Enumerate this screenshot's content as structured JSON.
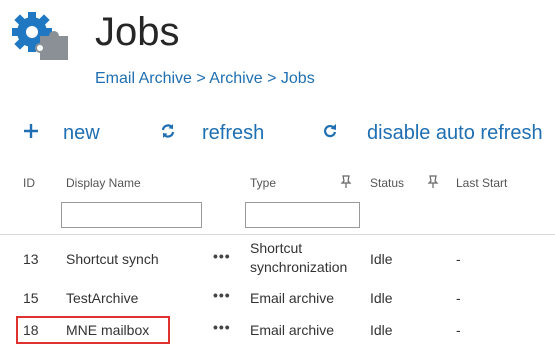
{
  "page": {
    "title": "Jobs",
    "breadcrumb": [
      "Email Archive",
      "Archive",
      "Jobs"
    ],
    "breadcrumb_separator": ">"
  },
  "toolbar": {
    "new": {
      "icon": "plus-icon",
      "label": "new"
    },
    "refresh": {
      "icon": "refresh-icon",
      "label": "refresh"
    },
    "disable_auto_refresh": {
      "icon": "auto-refresh-icon",
      "label": "disable auto refresh"
    }
  },
  "grid": {
    "columns": {
      "id": "ID",
      "display_name": "Display Name",
      "type": "Type",
      "status": "Status",
      "last_start": "Last Start"
    },
    "filters": {
      "display_name": "",
      "type": ""
    },
    "row_menu_label": "•••",
    "rows": [
      {
        "id": "13",
        "display_name": "Shortcut synch",
        "type_line1": "Shortcut",
        "type_line2": "synchronization",
        "status": "Idle",
        "last_start": "-"
      },
      {
        "id": "15",
        "display_name": "TestArchive",
        "type": "Email archive",
        "status": "Idle",
        "last_start": "-"
      },
      {
        "id": "18",
        "display_name": "MNE mailbox",
        "type": "Email archive",
        "status": "Idle",
        "last_start": "-"
      }
    ]
  },
  "colors": {
    "accent": "#1f6fb2",
    "icon_blue": "#1f78c1",
    "icon_gray": "#8a9096",
    "highlight": "#e03131"
  }
}
